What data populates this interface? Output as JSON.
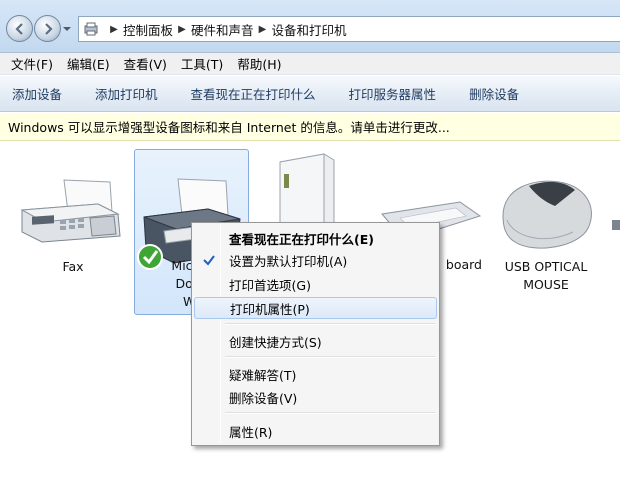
{
  "address": {
    "crumbs": [
      "控制面板",
      "硬件和声音",
      "设备和打印机"
    ]
  },
  "menu": {
    "items": [
      "文件(F)",
      "编辑(E)",
      "查看(V)",
      "工具(T)",
      "帮助(H)"
    ]
  },
  "commands": {
    "items": [
      "添加设备",
      "添加打印机",
      "查看现在正在打印什么",
      "打印服务器属性",
      "删除设备"
    ]
  },
  "infobar": {
    "text": "Windows 可以显示增强型设备图标和来自 Internet 的信息。请单击进行更改..."
  },
  "devices": {
    "fax": "Fax",
    "printer_line1": "Micros",
    "printer_line2": "Docu",
    "printer_line3": "Wr",
    "keyboard": "board",
    "mouse_line1": "USB OPTICAL",
    "mouse_line2": "MOUSE"
  },
  "context_menu": {
    "see_printing": "查看现在正在打印什么(E)",
    "set_default": "设置为默认打印机(A)",
    "printing_prefs": "打印首选项(G)",
    "printer_props": "打印机属性(P)",
    "create_shortcut": "创建快捷方式(S)",
    "troubleshoot": "疑难解答(T)",
    "remove_device": "删除设备(V)",
    "properties": "属性(R)"
  }
}
